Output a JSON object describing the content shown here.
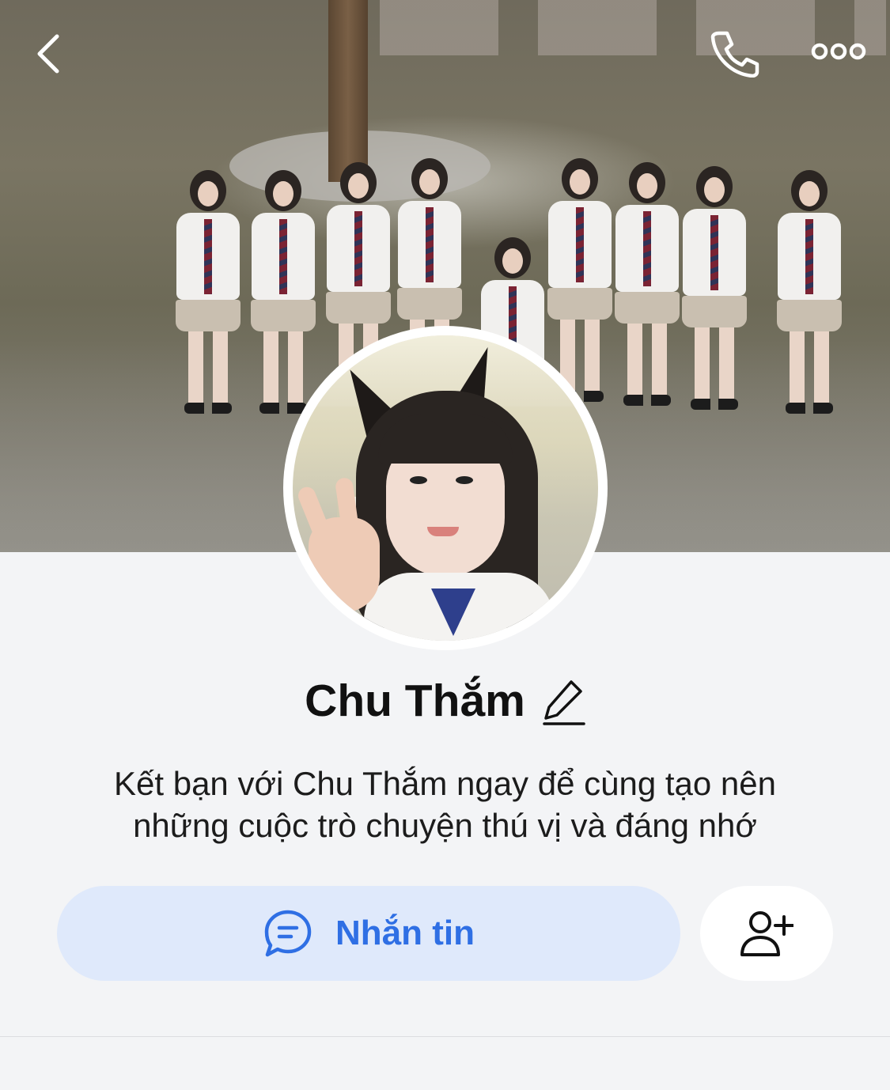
{
  "header": {
    "back_icon": "chevron-left-icon",
    "call_icon": "phone-icon",
    "more_icon": "more-horizontal-icon"
  },
  "profile": {
    "name": "Chu Thắm",
    "edit_icon": "pencil-icon",
    "intro_line_1": "Kết bạn với Chu Thắm ngay để cùng tạo nên",
    "intro_line_2": "những cuộc trò chuyện thú vị và đáng nhớ"
  },
  "actions": {
    "message_label": "Nhắn tin",
    "message_icon": "chat-bubble-icon",
    "add_friend_icon": "add-user-icon"
  },
  "colors": {
    "accent": "#2f6fe4",
    "message_button_bg": "#dfe9fb",
    "page_bg": "#f3f4f6"
  }
}
